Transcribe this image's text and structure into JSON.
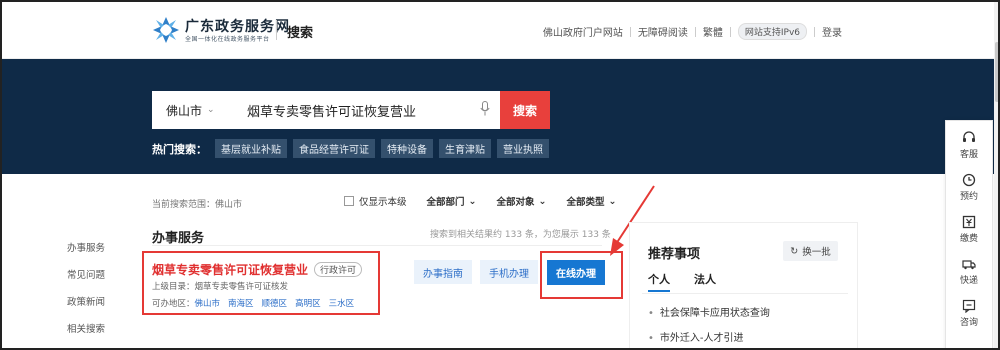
{
  "header": {
    "site_title": "广东政务服务网",
    "site_subtitle": "全国一体化在线政务服务平台",
    "page_title": "搜索",
    "links": [
      "佛山政府门户网站",
      "无障碍阅读",
      "繁體",
      "网站支持IPv6",
      "登录"
    ]
  },
  "search": {
    "city": "佛山市",
    "query": "烟草专卖零售许可证恢复营业",
    "button": "搜索",
    "hot_label": "热门搜索：",
    "hot_tags": [
      "基层就业补贴",
      "食品经营许可证",
      "特种设备",
      "生育津贴",
      "营业执照"
    ]
  },
  "filters": {
    "scope_label": "当前搜索范围：",
    "scope_value": "佛山市",
    "only_this_level": "仅显示本级",
    "dept": "全部部门",
    "target": "全部对象",
    "type": "全部类型"
  },
  "leftnav": [
    "办事服务",
    "常见问题",
    "政策新闻",
    "相关搜索"
  ],
  "results": {
    "section_title": "办事服务",
    "count_text": "搜索到相关结果约 133 条，为您展示 133 条",
    "item": {
      "title": "烟草专卖零售许可证恢复营业",
      "badge": "行政许可",
      "parent": "上级目录：烟草专卖零售许可证核发",
      "areas_label": "可办地区：",
      "areas": [
        "佛山市",
        "南海区",
        "顺德区",
        "高明区",
        "三水区"
      ],
      "btn_guide": "办事指南",
      "btn_mobile": "手机办理",
      "btn_online": "在线办理"
    }
  },
  "recommend": {
    "title": "推荐事项",
    "refresh": "换一批",
    "tabs": [
      "个人",
      "法人"
    ],
    "items": [
      "社会保障卡应用状态查询",
      "市外迁入-人才引进"
    ]
  },
  "rightbar": [
    "客服",
    "预约",
    "缴费",
    "快递",
    "咨询"
  ],
  "colors": {
    "banner": "#0f2a47",
    "accent_red": "#e8403c",
    "primary_blue": "#1677d2"
  }
}
